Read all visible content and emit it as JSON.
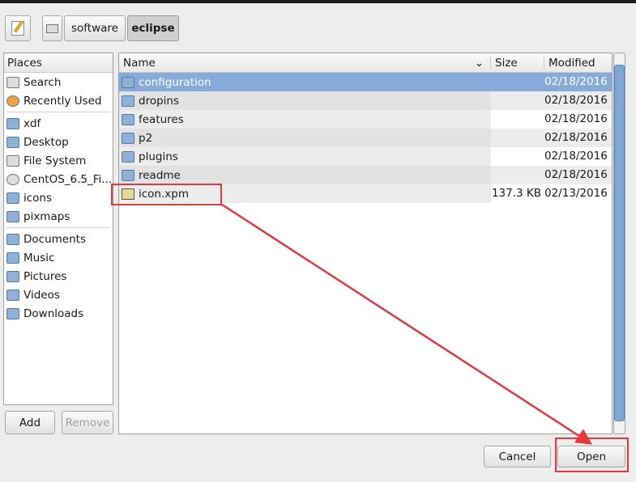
{
  "path_bar": {
    "segments": [
      "software",
      "eclipse"
    ],
    "active": "eclipse"
  },
  "places": {
    "header": "Places",
    "groups": [
      [
        {
          "label": "Search",
          "icon": "binoculars-icon"
        },
        {
          "label": "Recently Used",
          "icon": "clock-icon"
        }
      ],
      [
        {
          "label": "xdf",
          "icon": "home-folder-icon"
        },
        {
          "label": "Desktop",
          "icon": "desktop-folder-icon"
        },
        {
          "label": "File System",
          "icon": "drive-icon"
        },
        {
          "label": "CentOS_6.5_Fi...",
          "icon": "disc-icon"
        },
        {
          "label": "icons",
          "icon": "folder-icon"
        },
        {
          "label": "pixmaps",
          "icon": "folder-icon"
        }
      ],
      [
        {
          "label": "Documents",
          "icon": "folder-icon"
        },
        {
          "label": "Music",
          "icon": "folder-icon"
        },
        {
          "label": "Pictures",
          "icon": "folder-icon"
        },
        {
          "label": "Videos",
          "icon": "folder-icon"
        },
        {
          "label": "Downloads",
          "icon": "folder-icon"
        }
      ]
    ],
    "add": "Add",
    "remove": "Remove"
  },
  "files": {
    "columns": {
      "name": "Name",
      "size": "Size",
      "modified": "Modified"
    },
    "rows": [
      {
        "name": "configuration",
        "size": "",
        "modified": "02/18/2016",
        "type": "folder",
        "selected": true
      },
      {
        "name": "dropins",
        "size": "",
        "modified": "02/18/2016",
        "type": "folder"
      },
      {
        "name": "features",
        "size": "",
        "modified": "02/18/2016",
        "type": "folder"
      },
      {
        "name": "p2",
        "size": "",
        "modified": "02/18/2016",
        "type": "folder"
      },
      {
        "name": "plugins",
        "size": "",
        "modified": "02/18/2016",
        "type": "folder"
      },
      {
        "name": "readme",
        "size": "",
        "modified": "02/18/2016",
        "type": "folder"
      },
      {
        "name": "icon.xpm",
        "size": "137.3 KB",
        "modified": "02/13/2016",
        "type": "image"
      }
    ]
  },
  "actions": {
    "cancel": "Cancel",
    "open": "Open"
  },
  "colors": {
    "selection": "#86abd9",
    "annotation": "#e8373b"
  }
}
